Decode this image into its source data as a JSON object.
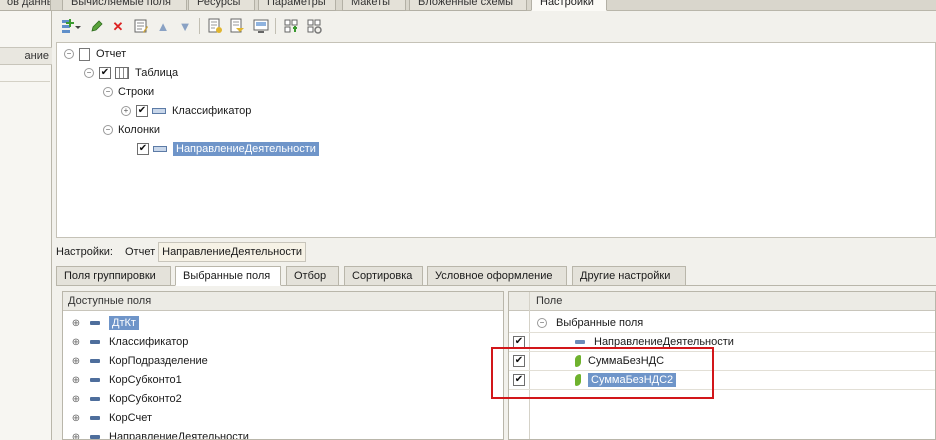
{
  "top_tabs": [
    "ов данных",
    "Вычисляемые поля",
    "Ресурсы",
    "Параметры",
    "Макеты",
    "Вложенные схемы",
    "Настройки"
  ],
  "left_panel": {
    "header": "ание"
  },
  "toolbar": {
    "icons": [
      "add-dropdown-icon",
      "pencil-icon",
      "delete-icon",
      "edit-grid-icon",
      "move-up-icon",
      "move-down-icon",
      "doc-settings-icon",
      "doc-settings-2-icon",
      "doc-settings-3-icon",
      "add-group-icon",
      "settings-icon"
    ]
  },
  "structure_tree": {
    "report": "Отчет",
    "table": "Таблица",
    "rows": "Строки",
    "classifier": "Классификатор",
    "columns": "Колонки",
    "direction": "НаправлениеДеятельности"
  },
  "settings_row": {
    "label": "Настройки:",
    "crumb1": "Отчет",
    "crumb2": "НаправлениеДеятельности"
  },
  "settings_tabs": [
    "Поля группировки",
    "Выбранные поля",
    "Отбор",
    "Сортировка",
    "Условное оформление",
    "Другие настройки"
  ],
  "available_fields": {
    "header": "Доступные поля",
    "items": [
      "ДтКт",
      "Классификатор",
      "КорПодразделение",
      "КорСубконто1",
      "КорСубконто2",
      "КорСчет",
      "НаправлениеДеятельности"
    ]
  },
  "selected_fields": {
    "header": "Поле",
    "group": "Выбранные поля",
    "items": [
      "НаправлениеДеятельности",
      "СуммаБезНДС",
      "СуммаБезНДС2"
    ]
  },
  "colors": {
    "selection": "#6f95c9",
    "highlight_box": "#d2161a",
    "resource_icon": "#6fb22e"
  }
}
